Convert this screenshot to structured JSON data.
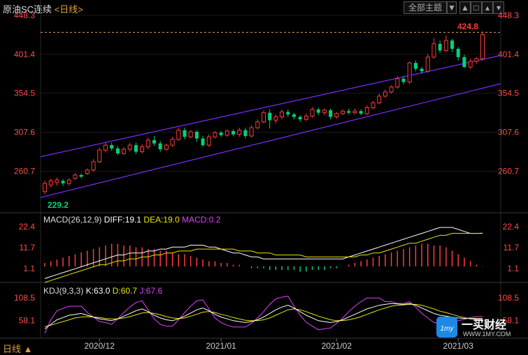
{
  "title": {
    "name": "原油SC连续",
    "period": "<日线>"
  },
  "controls": {
    "menu_label": "全部主题",
    "dropdown_icon": "triangle-down-icon",
    "icons": [
      "triangle-up-icon",
      "square-icon",
      "chevron-up-icon",
      "chevron-down-icon"
    ]
  },
  "colors": {
    "up": "#ff3b3b",
    "down": "#00d27a",
    "channel": "#7b2cff",
    "dif": "#ffffff",
    "dea": "#e6e600",
    "j": "#e040fb",
    "axis_text": "#ff4b4b",
    "price_label": "#ff3b3b"
  },
  "main_axis": {
    "ticks": [
      "448.3",
      "401.4",
      "354.5",
      "307.6",
      "260.7"
    ]
  },
  "price_labels": {
    "high": "424.8",
    "low": "229.2"
  },
  "macd": {
    "label": "MACD(26,12,9)",
    "dif": "DIFF:19.1",
    "dea": "DEA:19.0",
    "macd": "MACD:0.2",
    "ticks": [
      "22.4",
      "11.7",
      "1.1"
    ]
  },
  "kdj": {
    "label": "KDJ(9,3,3)",
    "k": "K:63.0",
    "d": "D:60.7",
    "j": "J:67.6",
    "ticks": [
      "108.5",
      "58.1"
    ]
  },
  "x_axis": {
    "ticks": [
      "2020/12",
      "2021/01",
      "2021/02",
      "2021/03"
    ]
  },
  "bottom": {
    "period_label": "日线 ▲"
  },
  "watermark": {
    "brand": "一买财经",
    "url": "WWW.1MY.COM"
  },
  "chart_data": {
    "type": "candlestick",
    "ylim": [
      229.2,
      448.3
    ],
    "candles": [
      [
        236,
        246,
        233,
        249
      ],
      [
        244,
        249,
        241,
        252
      ],
      [
        247,
        250,
        243,
        253
      ],
      [
        249,
        246,
        243,
        251
      ],
      [
        246,
        250,
        243,
        252
      ],
      [
        252,
        256,
        250,
        258
      ],
      [
        256,
        254,
        252,
        258
      ],
      [
        258,
        262,
        256,
        264
      ],
      [
        262,
        272,
        260,
        275
      ],
      [
        272,
        286,
        270,
        289
      ],
      [
        286,
        292,
        283,
        295
      ],
      [
        292,
        288,
        285,
        295
      ],
      [
        288,
        282,
        280,
        291
      ],
      [
        282,
        287,
        280,
        290
      ],
      [
        287,
        292,
        284,
        295
      ],
      [
        292,
        284,
        281,
        295
      ],
      [
        284,
        290,
        282,
        293
      ],
      [
        290,
        298,
        287,
        301
      ],
      [
        298,
        294,
        291,
        303
      ],
      [
        294,
        287,
        284,
        297
      ],
      [
        287,
        292,
        285,
        294
      ],
      [
        292,
        299,
        290,
        302
      ],
      [
        299,
        310,
        297,
        313
      ],
      [
        310,
        302,
        299,
        313
      ],
      [
        302,
        308,
        300,
        310
      ],
      [
        308,
        300,
        296,
        310
      ],
      [
        300,
        292,
        290,
        303
      ],
      [
        292,
        302,
        290,
        305
      ],
      [
        302,
        307,
        300,
        309
      ],
      [
        307,
        304,
        302,
        309
      ],
      [
        304,
        309,
        302,
        311
      ],
      [
        309,
        305,
        303,
        311
      ],
      [
        305,
        310,
        302,
        313
      ],
      [
        310,
        303,
        300,
        313
      ],
      [
        303,
        313,
        301,
        316
      ],
      [
        313,
        320,
        311,
        323
      ],
      [
        320,
        331,
        318,
        334
      ],
      [
        331,
        322,
        312,
        335
      ],
      [
        322,
        326,
        318,
        329
      ],
      [
        326,
        332,
        323,
        335
      ],
      [
        332,
        329,
        326,
        335
      ],
      [
        329,
        326,
        323,
        331
      ],
      [
        326,
        323,
        320,
        328
      ],
      [
        323,
        327,
        321,
        330
      ],
      [
        327,
        335,
        325,
        338
      ],
      [
        335,
        331,
        328,
        337
      ],
      [
        331,
        334,
        328,
        336
      ],
      [
        334,
        326,
        323,
        336
      ],
      [
        326,
        330,
        324,
        332
      ],
      [
        330,
        333,
        328,
        335
      ],
      [
        333,
        331,
        329,
        336
      ],
      [
        331,
        333,
        329,
        336
      ],
      [
        333,
        330,
        328,
        335
      ],
      [
        330,
        337,
        328,
        340
      ],
      [
        337,
        343,
        335,
        345
      ],
      [
        343,
        351,
        341,
        354
      ],
      [
        351,
        356,
        349,
        359
      ],
      [
        356,
        362,
        354,
        364
      ],
      [
        362,
        372,
        360,
        375
      ],
      [
        372,
        368,
        365,
        375
      ],
      [
        368,
        391,
        366,
        393
      ],
      [
        391,
        384,
        381,
        394
      ],
      [
        384,
        381,
        378,
        386
      ],
      [
        381,
        398,
        379,
        402
      ],
      [
        398,
        414,
        396,
        421
      ],
      [
        414,
        406,
        403,
        418
      ],
      [
        406,
        418,
        404,
        424
      ],
      [
        418,
        408,
        404,
        420
      ],
      [
        408,
        398,
        394,
        410
      ],
      [
        398,
        386,
        385,
        401
      ],
      [
        386,
        393,
        384,
        396
      ],
      [
        393,
        396,
        390,
        398
      ],
      [
        396,
        425,
        394,
        429
      ]
    ],
    "channel_upper": [
      [
        0,
        278
      ],
      [
        72,
        400
      ]
    ],
    "channel_lower": [
      [
        0,
        229
      ],
      [
        72,
        366
      ]
    ],
    "macd_hist": [
      2,
      3,
      4,
      5,
      6,
      7,
      8,
      9,
      10,
      11,
      12,
      13,
      13,
      12,
      12,
      11,
      11,
      10,
      10,
      9,
      9,
      8,
      7,
      7,
      6,
      5,
      4,
      3,
      3,
      2,
      2,
      1,
      1,
      0,
      -1,
      -1,
      -1,
      -2,
      -2,
      -2,
      -2,
      -2,
      -3,
      -3,
      -2,
      -2,
      -2,
      -1,
      -1,
      0,
      1,
      2,
      3,
      4,
      5,
      6,
      7,
      8,
      9,
      10,
      11,
      12,
      13,
      13,
      12,
      12,
      11,
      9,
      7,
      5,
      3,
      1,
      0.2
    ],
    "macd_dif": [
      -4,
      -3,
      -2,
      -1,
      0,
      1,
      2,
      3,
      4,
      5,
      6,
      7,
      8,
      8,
      9,
      9,
      9,
      10,
      10,
      11,
      11,
      12,
      12,
      12,
      13,
      13,
      13,
      12,
      12,
      11,
      10,
      9,
      9,
      8,
      7,
      7,
      6,
      6,
      6,
      6,
      6,
      6,
      6,
      6,
      6,
      6,
      6,
      6,
      6,
      6,
      7,
      8,
      9,
      10,
      11,
      12,
      13,
      14,
      15,
      16,
      17,
      18,
      19,
      20,
      21,
      22,
      22,
      22,
      21,
      20,
      19,
      19,
      19.1
    ],
    "macd_dea": [
      -6,
      -5,
      -4,
      -3,
      -2,
      -1,
      0,
      1,
      2,
      3,
      3,
      4,
      5,
      5,
      6,
      6,
      7,
      7,
      8,
      8,
      9,
      9,
      10,
      10,
      10,
      11,
      11,
      11,
      11,
      11,
      11,
      11,
      10,
      10,
      10,
      9,
      9,
      9,
      8,
      8,
      8,
      8,
      8,
      7,
      7,
      7,
      7,
      7,
      7,
      7,
      7,
      7,
      8,
      8,
      9,
      9,
      10,
      11,
      12,
      13,
      14,
      14,
      15,
      16,
      17,
      18,
      18,
      19,
      19,
      19,
      19,
      19,
      19.0
    ],
    "kdj_k": [
      40,
      50,
      60,
      65,
      70,
      72,
      74,
      70,
      66,
      62,
      60,
      58,
      62,
      68,
      74,
      80,
      84,
      78,
      70,
      64,
      60,
      58,
      62,
      68,
      75,
      82,
      86,
      80,
      72,
      66,
      62,
      58,
      56,
      54,
      56,
      60,
      66,
      74,
      82,
      88,
      92,
      86,
      78,
      70,
      64,
      58,
      56,
      54,
      56,
      60,
      66,
      72,
      78,
      84,
      88,
      92,
      94,
      96,
      95,
      94,
      96,
      92,
      86,
      80,
      74,
      70,
      68,
      66,
      64,
      63,
      63,
      63,
      63.0
    ],
    "kdj_d": [
      45,
      48,
      52,
      56,
      60,
      64,
      66,
      67,
      66,
      65,
      63,
      62,
      62,
      64,
      67,
      71,
      75,
      76,
      74,
      71,
      67,
      64,
      63,
      64,
      68,
      72,
      77,
      78,
      76,
      72,
      69,
      65,
      62,
      59,
      58,
      58,
      60,
      64,
      70,
      76,
      82,
      84,
      82,
      78,
      73,
      68,
      64,
      60,
      58,
      58,
      60,
      63,
      67,
      72,
      77,
      82,
      86,
      90,
      92,
      93,
      94,
      94,
      92,
      88,
      84,
      79,
      76,
      72,
      68,
      65,
      62,
      61,
      60.7
    ],
    "kdj_j": [
      30,
      60,
      80,
      85,
      90,
      90,
      90,
      76,
      66,
      56,
      54,
      50,
      62,
      76,
      88,
      98,
      102,
      82,
      62,
      50,
      46,
      46,
      60,
      76,
      90,
      102,
      104,
      84,
      64,
      54,
      48,
      44,
      44,
      44,
      52,
      64,
      78,
      94,
      106,
      110,
      112,
      90,
      70,
      54,
      46,
      38,
      40,
      42,
      52,
      64,
      78,
      90,
      100,
      108,
      108,
      108,
      100,
      100,
      96,
      96,
      100,
      88,
      74,
      64,
      54,
      52,
      52,
      54,
      58,
      61,
      65,
      67,
      67.6
    ]
  }
}
